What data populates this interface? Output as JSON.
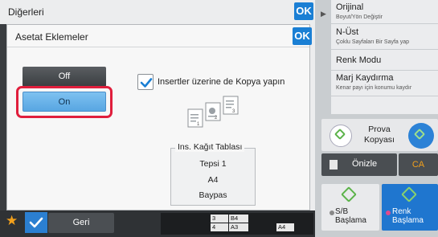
{
  "outer": {
    "title": "Diğerleri",
    "ok_label": "OK"
  },
  "dialog": {
    "title": "Asetat Eklemeler",
    "ok_label": "OK",
    "off_label": "Off",
    "on_label": "On",
    "checkbox": {
      "label": "Insertler üzerine de Kopya yapın",
      "checked": true
    },
    "tray": {
      "legend": "Ins. Kağıt Tablası",
      "lines": [
        "Tepsi 1",
        "A4",
        "Baypas"
      ]
    }
  },
  "bottom": {
    "back_label": "Geri",
    "sizes": [
      "3",
      "B4",
      "4",
      "A3",
      "A4"
    ]
  },
  "right": {
    "items": [
      {
        "main": "Orijinal",
        "sub": "Boyut/Yön Değiştir"
      },
      {
        "main": "N-Üst",
        "sub": "Çoklu Sayfaları Bir Sayfa yap"
      },
      {
        "main": "Renk Modu",
        "sub": ""
      },
      {
        "main": "Marj Kaydırma",
        "sub": "Kenar payı için konumu kaydır"
      }
    ],
    "proof_label": "Prova Kopyası",
    "preview_label": "Önizle",
    "ca_label": "CA",
    "bw_label_1": "S/B",
    "bw_label_2": "Başlama",
    "color_label_1": "Renk",
    "color_label_2": "Başlama"
  },
  "colors": {
    "accent": "#1a7fd4",
    "highlight": "#e01e3c",
    "star": "#f2a01c"
  }
}
